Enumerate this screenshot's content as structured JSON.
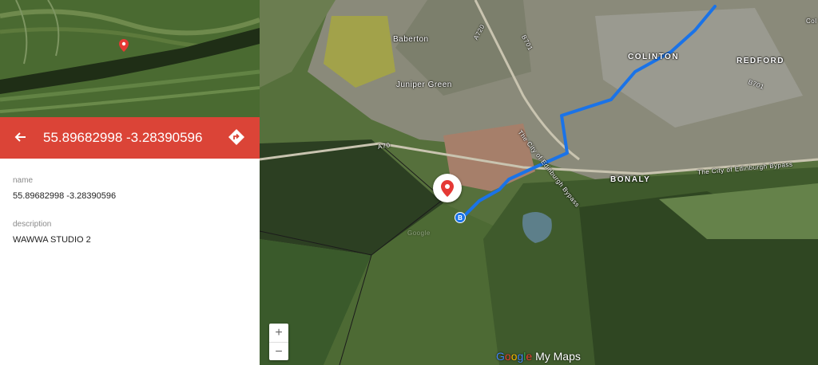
{
  "panel": {
    "header_title": "55.89682998 -3.28390596",
    "back_icon": "arrow-left-icon",
    "directions_icon": "directions-icon",
    "fields": [
      {
        "label": "name",
        "value": "55.89682998 -3.28390596"
      },
      {
        "label": "description",
        "value": "WAWWA STUDIO 2"
      }
    ]
  },
  "map": {
    "labels": {
      "baberton": "Baberton",
      "juniper_green": "Juniper Green",
      "colinton": "COLINTON",
      "redford": "REDFORD",
      "bonaly": "BONALY",
      "bypass_1": "The City of Edinburgh Bypass",
      "bypass_2": "The City of Edinburgh Bypass",
      "a720": "A720",
      "b701_a": "B701",
      "b701_b": "B701",
      "a70": "A70",
      "col": "Col",
      "watermark": "Google"
    },
    "route_marker": "B",
    "zoom_in": "+",
    "zoom_out": "−",
    "attribution": {
      "g1": "G",
      "g2": "o",
      "g3": "o",
      "g4": "g",
      "g5": "l",
      "g6": "e",
      "rest": " My Maps"
    },
    "colors": {
      "accent": "#db4437",
      "route": "#1a73e8"
    }
  }
}
